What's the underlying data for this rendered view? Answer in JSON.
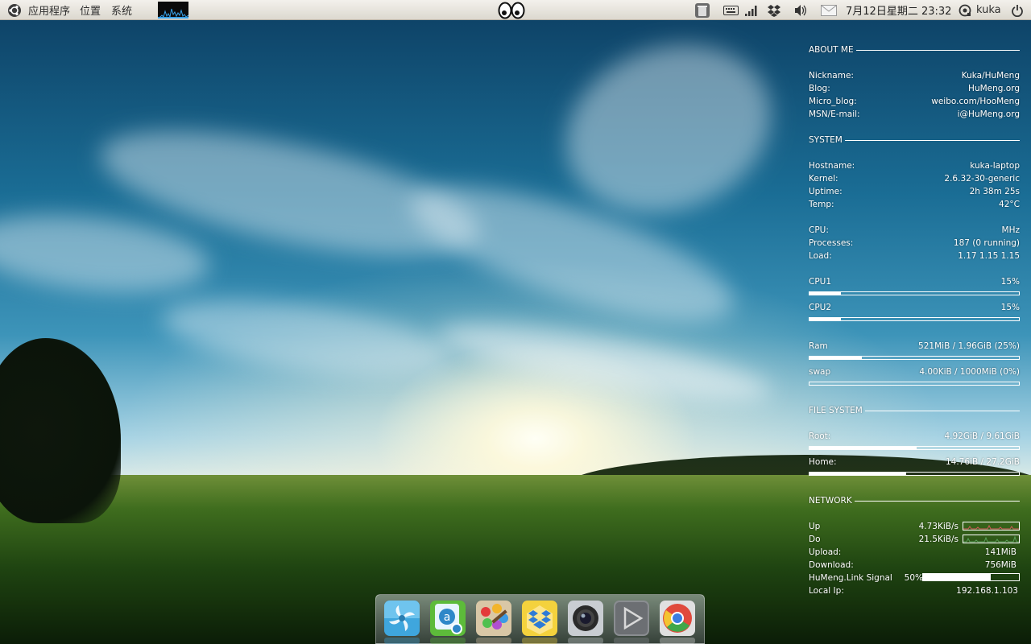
{
  "panel": {
    "menu_applications": "应用程序",
    "menu_places": "位置",
    "menu_system": "系统",
    "datetime": "7月12日星期二 23:32",
    "username": "kuka"
  },
  "conky": {
    "about": {
      "title": "ABOUT ME",
      "rows": [
        {
          "label": "Nickname:",
          "value": "Kuka/HuMeng"
        },
        {
          "label": "Blog:",
          "value": "HuMeng.org"
        },
        {
          "label": "Micro_blog:",
          "value": "weibo.com/HooMeng"
        },
        {
          "label": "MSN/E-mail:",
          "value": "i@HuMeng.org"
        }
      ]
    },
    "system": {
      "title": "SYSTEM",
      "rows": [
        {
          "label": "Hostname:",
          "value": "kuka-laptop"
        },
        {
          "label": "Kernel:",
          "value": "2.6.32-30-generic"
        },
        {
          "label": "Uptime:",
          "value": "2h 38m 25s"
        },
        {
          "label": "Temp:",
          "value": "42°C"
        }
      ],
      "rows2": [
        {
          "label": "CPU:",
          "value": "MHz"
        },
        {
          "label": "Processes:",
          "value": "187 (0 running)"
        },
        {
          "label": "Load:",
          "value": "1.17 1.15 1.15"
        }
      ],
      "meters": [
        {
          "label": "CPU1",
          "value": "15%",
          "fraction": 0.15
        },
        {
          "label": "CPU2",
          "value": "15%",
          "fraction": 0.15
        }
      ],
      "memory": [
        {
          "label": "Ram",
          "value": "521MiB / 1.96GiB (25%)",
          "fraction": 0.25
        },
        {
          "label": "swap",
          "value": "4.00KiB / 1000MiB (0%)",
          "fraction": 0.0
        }
      ]
    },
    "filesystem": {
      "title": "FILE SYSTEM",
      "rows": [
        {
          "label": "Root:",
          "value": "4.92GiB / 9.61GiB",
          "fraction": 0.51
        },
        {
          "label": "Home:",
          "value": "14.76iB / 27.2GiB",
          "fraction": 0.46
        }
      ]
    },
    "network": {
      "title": "NETWORK",
      "up_label": "Up",
      "up_value": "4.73KiB/s",
      "down_label": "Do",
      "down_value": "21.5KiB/s",
      "upload_label": "Upload:",
      "upload_value": "141MiB",
      "download_label": "Download:",
      "download_value": "756MiB",
      "signal_label": "HuMeng.Link Signal",
      "signal_value": "50%",
      "signal_fraction": 0.71,
      "ip_label": "Local Ip:",
      "ip_value": "192.168.1.103"
    }
  },
  "dock_apps": [
    "nautilus-app-icon",
    "software-center-icon",
    "gimp-paint-icon",
    "dropbox-app-icon",
    "camera-app-icon",
    "media-player-icon",
    "chrome-app-icon"
  ],
  "colors": {
    "panel_bg": "#e9e6df",
    "conky_text": "#ffffff",
    "up_graph": "#d05a5a",
    "down_graph": "#5aa05a"
  }
}
